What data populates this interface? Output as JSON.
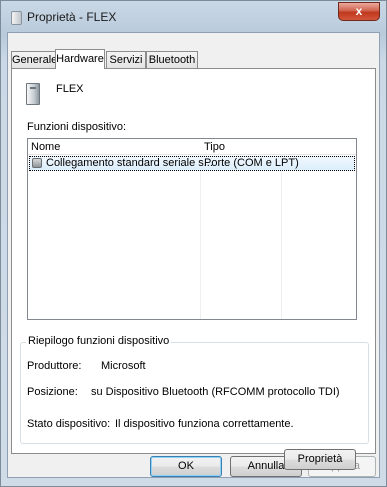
{
  "window": {
    "title": "Proprietà - FLEX",
    "close_label": "x"
  },
  "tabs": [
    {
      "label": "Generale"
    },
    {
      "label": "Hardware",
      "active": true
    },
    {
      "label": "Servizi"
    },
    {
      "label": "Bluetooth"
    }
  ],
  "device": {
    "name": "FLEX",
    "icon": "device-icon"
  },
  "functions": {
    "label": "Funzioni dispositivo:",
    "columns": [
      "Nome",
      "Tipo"
    ],
    "rows": [
      {
        "name": "Collegamento standard seriale s...",
        "type": "Porte (COM e LPT)",
        "icon": "serial-port-icon"
      }
    ]
  },
  "summary": {
    "title": "Riepilogo funzioni dispositivo",
    "manufacturer_label": "Produttore:",
    "manufacturer_value": "Microsoft",
    "location_label": "Posizione:",
    "location_value": "su Dispositivo Bluetooth (RFCOMM protocollo TDI)",
    "status_label": "Stato dispositivo:",
    "status_value": "Il dispositivo funziona correttamente."
  },
  "buttons": {
    "properties": "Proprietà",
    "ok": "OK",
    "cancel": "Annulla",
    "apply": "Applica"
  },
  "colors": {
    "close_button": "#c0391f",
    "selection": "#dbeefc"
  }
}
